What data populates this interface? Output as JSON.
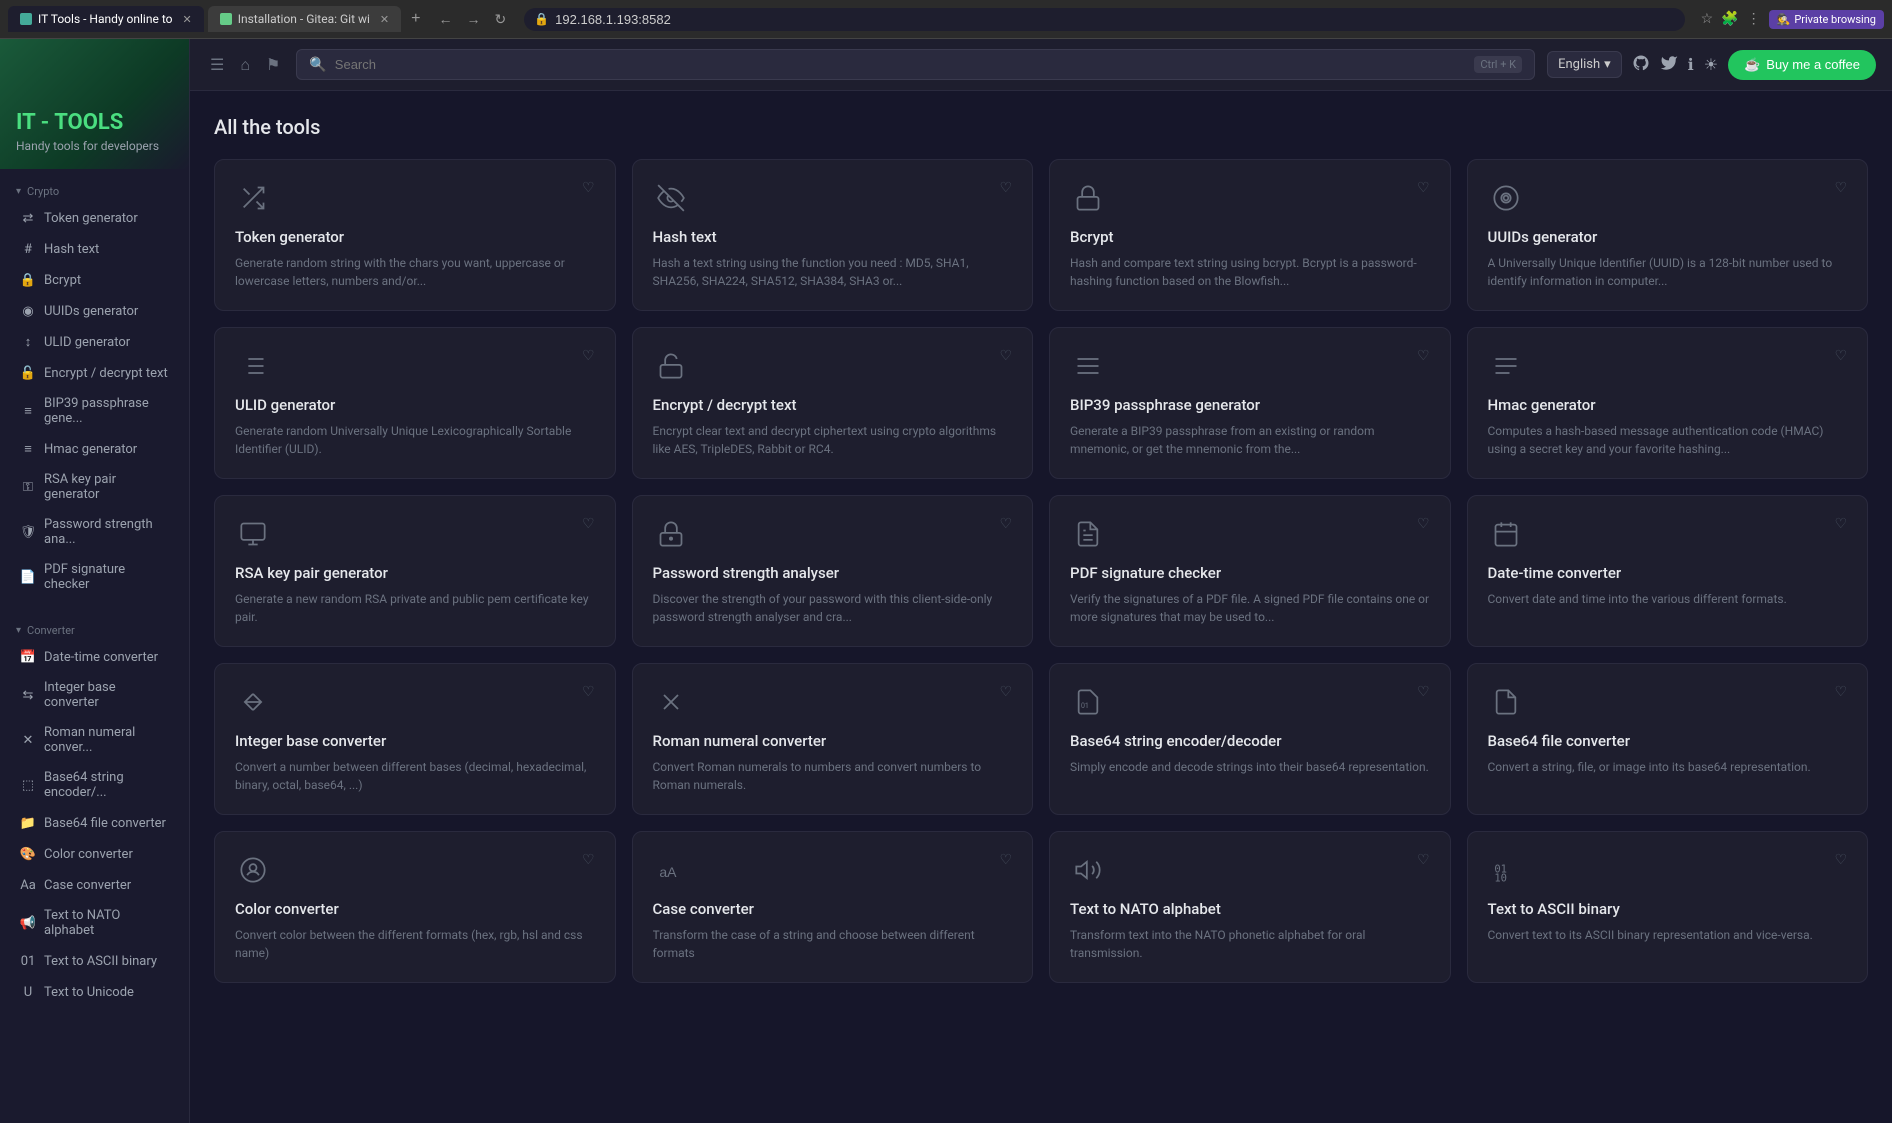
{
  "browser": {
    "tabs": [
      {
        "id": "it-tools",
        "label": "IT Tools - Handy online to",
        "active": true,
        "favicon": "green"
      },
      {
        "id": "gitea",
        "label": "Installation - Gitea: Git wi",
        "active": false,
        "favicon": "gitea"
      }
    ],
    "url": "192.168.1.193:8582",
    "private_label": "Private browsing"
  },
  "topbar": {
    "search_placeholder": "Search",
    "search_shortcut": "Ctrl + K",
    "language": "English",
    "coffee_btn": "Buy me a coffee"
  },
  "sidebar": {
    "logo_title": "IT - TOOLS",
    "logo_subtitle": "Handy tools for developers",
    "sections": [
      {
        "label": "Crypto",
        "items": [
          {
            "id": "token-generator",
            "label": "Token generator",
            "icon": "shuffle"
          },
          {
            "id": "hash-text",
            "label": "Hash text",
            "icon": "hash"
          },
          {
            "id": "bcrypt",
            "label": "Bcrypt",
            "icon": "lock"
          },
          {
            "id": "uuids-generator",
            "label": "UUIDs generator",
            "icon": "fingerprint"
          },
          {
            "id": "ulid-generator",
            "label": "ULID generator",
            "icon": "sort"
          },
          {
            "id": "encrypt-decrypt",
            "label": "Encrypt / decrypt text",
            "icon": "lock2"
          },
          {
            "id": "bip39",
            "label": "BIP39 passphrase gene...",
            "icon": "list"
          },
          {
            "id": "hmac",
            "label": "Hmac generator",
            "icon": "lines"
          },
          {
            "id": "rsa-key",
            "label": "RSA key pair generator",
            "icon": "key"
          },
          {
            "id": "password-strength",
            "label": "Password strength ana...",
            "icon": "shield"
          },
          {
            "id": "pdf-signature",
            "label": "PDF signature checker",
            "icon": "pdf"
          }
        ]
      },
      {
        "label": "Converter",
        "items": [
          {
            "id": "date-time",
            "label": "Date-time converter",
            "icon": "calendar"
          },
          {
            "id": "integer-base",
            "label": "Integer base converter",
            "icon": "base"
          },
          {
            "id": "roman-numeral",
            "label": "Roman numeral conver...",
            "icon": "roman"
          },
          {
            "id": "base64-string",
            "label": "Base64 string encoder/...",
            "icon": "b64"
          },
          {
            "id": "base64-file",
            "label": "Base64 file converter",
            "icon": "file"
          },
          {
            "id": "color-converter",
            "label": "Color converter",
            "icon": "color"
          },
          {
            "id": "case-converter",
            "label": "Case converter",
            "icon": "case"
          },
          {
            "id": "text-nato",
            "label": "Text to NATO alphabet",
            "icon": "nato"
          },
          {
            "id": "text-ascii",
            "label": "Text to ASCII binary",
            "icon": "ascii"
          },
          {
            "id": "text-unicode",
            "label": "Text to Unicode",
            "icon": "unicode"
          }
        ]
      }
    ]
  },
  "page": {
    "title": "All the tools"
  },
  "tools": [
    {
      "id": "token-generator",
      "name": "Token generator",
      "desc": "Generate random string with the chars you want, uppercase or lowercase letters, numbers and/or...",
      "icon": "shuffle"
    },
    {
      "id": "hash-text",
      "name": "Hash text",
      "desc": "Hash a text string using the function you need : MD5, SHA1, SHA256, SHA224, SHA512, SHA384, SHA3 or...",
      "icon": "eye-off"
    },
    {
      "id": "bcrypt",
      "name": "Bcrypt",
      "desc": "Hash and compare text string using bcrypt. Bcrypt is a password-hashing function based on the Blowfish...",
      "icon": "lock-closed"
    },
    {
      "id": "uuids-generator",
      "name": "UUIDs generator",
      "desc": "A Universally Unique Identifier (UUID) is a 128-bit number used to identify information in computer...",
      "icon": "fingerprint"
    },
    {
      "id": "ulid-generator",
      "name": "ULID generator",
      "desc": "Generate random Universally Unique Lexicographically Sortable Identifier (ULID).",
      "icon": "sort-num"
    },
    {
      "id": "encrypt-decrypt",
      "name": "Encrypt / decrypt text",
      "desc": "Encrypt clear text and decrypt ciphertext using crypto algorithms like AES, TripleDES, Rabbit or RC4.",
      "icon": "lock-open"
    },
    {
      "id": "bip39",
      "name": "BIP39 passphrase generator",
      "desc": "Generate a BIP39 passphrase from an existing or random mnemonic, or get the mnemonic from the...",
      "icon": "menu-lines"
    },
    {
      "id": "hmac",
      "name": "Hmac generator",
      "desc": "Computes a hash-based message authentication code (HMAC) using a secret key and your favorite hashing...",
      "icon": "lines2"
    },
    {
      "id": "rsa-key-pair",
      "name": "RSA key pair generator",
      "desc": "Generate a new random RSA private and public pem certificate key pair.",
      "icon": "rsa"
    },
    {
      "id": "password-strength",
      "name": "Password strength analyser",
      "desc": "Discover the strength of your password with this client-side-only password strength analyser and cra...",
      "icon": "password"
    },
    {
      "id": "pdf-signature",
      "name": "PDF signature checker",
      "desc": "Verify the signatures of a PDF file. A signed PDF file contains one or more signatures that may be used to...",
      "icon": "pdf-file"
    },
    {
      "id": "date-time",
      "name": "Date-time converter",
      "desc": "Convert date and time into the various different formats.",
      "icon": "calendar"
    },
    {
      "id": "integer-base",
      "name": "Integer base converter",
      "desc": "Convert a number between different bases (decimal, hexadecimal, binary, octal, base64, ...)",
      "icon": "arrows-lr"
    },
    {
      "id": "roman-numeral",
      "name": "Roman numeral converter",
      "desc": "Convert Roman numerals to numbers and convert numbers to Roman numerals.",
      "icon": "roman-x"
    },
    {
      "id": "base64-string",
      "name": "Base64 string encoder/decoder",
      "desc": "Simply encode and decode strings into their base64 representation.",
      "icon": "base64-str"
    },
    {
      "id": "base64-file",
      "name": "Base64 file converter",
      "desc": "Convert a string, file, or image into its base64 representation.",
      "icon": "base64-file"
    },
    {
      "id": "color-converter",
      "name": "Color converter",
      "desc": "Convert color between the different formats (hex, rgb, hsl and css name)",
      "icon": "palette"
    },
    {
      "id": "case-converter",
      "name": "Case converter",
      "desc": "Transform the case of a string and choose between different formats",
      "icon": "case-aa"
    },
    {
      "id": "text-nato",
      "name": "Text to NATO alphabet",
      "desc": "Transform text into the NATO phonetic alphabet for oral transmission.",
      "icon": "megaphone"
    },
    {
      "id": "text-ascii-binary",
      "name": "Text to ASCII binary",
      "desc": "Convert text to its ASCII binary representation and vice-versa.",
      "icon": "binary"
    }
  ]
}
